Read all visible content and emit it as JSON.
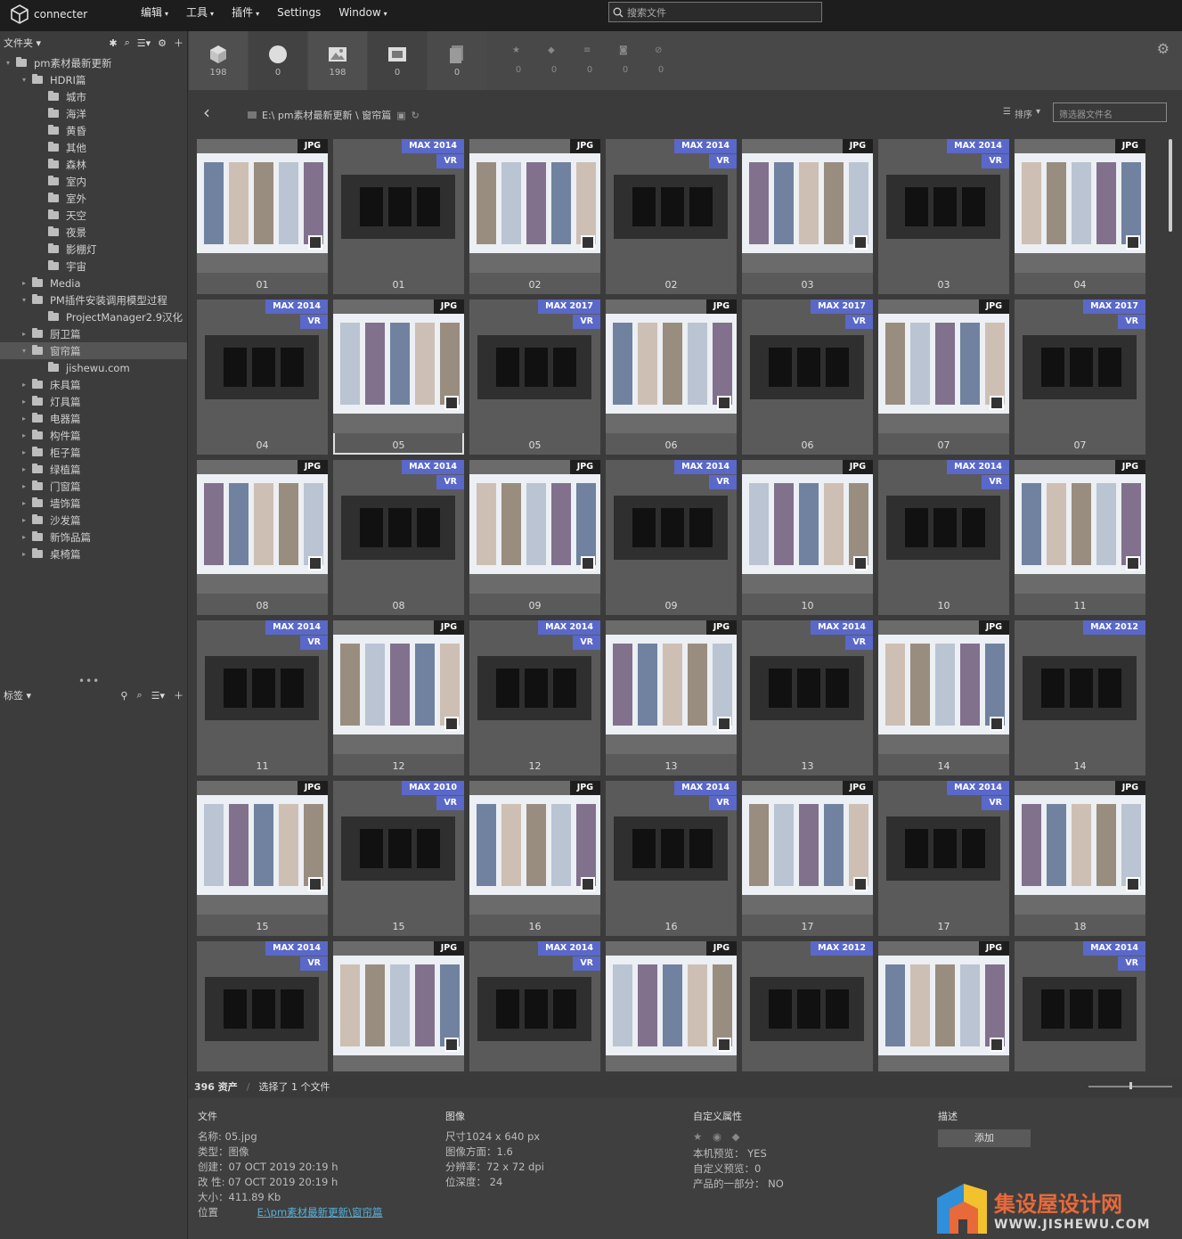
{
  "app": {
    "name": "connecter"
  },
  "menu": [
    {
      "label": "编辑",
      "caret": true
    },
    {
      "label": "工具",
      "caret": true
    },
    {
      "label": "插件",
      "caret": true
    },
    {
      "label": "Settings",
      "caret": false
    },
    {
      "label": "Window",
      "caret": true
    }
  ],
  "search": {
    "placeholder": "搜索文件"
  },
  "sidebar": {
    "header": "文件夹",
    "tree": [
      {
        "label": "pm素材最新更新",
        "depth": 0,
        "arrow": "▾"
      },
      {
        "label": "HDRI篇",
        "depth": 1,
        "arrow": "▾"
      },
      {
        "label": "城市",
        "depth": 2,
        "arrow": ""
      },
      {
        "label": "海洋",
        "depth": 2,
        "arrow": ""
      },
      {
        "label": "黄昏",
        "depth": 2,
        "arrow": ""
      },
      {
        "label": "其他",
        "depth": 2,
        "arrow": ""
      },
      {
        "label": "森林",
        "depth": 2,
        "arrow": ""
      },
      {
        "label": "室内",
        "depth": 2,
        "arrow": ""
      },
      {
        "label": "室外",
        "depth": 2,
        "arrow": ""
      },
      {
        "label": "天空",
        "depth": 2,
        "arrow": ""
      },
      {
        "label": "夜景",
        "depth": 2,
        "arrow": ""
      },
      {
        "label": "影棚灯",
        "depth": 2,
        "arrow": ""
      },
      {
        "label": "宇宙",
        "depth": 2,
        "arrow": ""
      },
      {
        "label": "Media",
        "depth": 1,
        "arrow": "▸"
      },
      {
        "label": "PM插件安装调用模型过程",
        "depth": 1,
        "arrow": "▾"
      },
      {
        "label": "ProjectManager2.9汉化",
        "depth": 2,
        "arrow": ""
      },
      {
        "label": "厨卫篇",
        "depth": 1,
        "arrow": "▸"
      },
      {
        "label": "窗帘篇",
        "depth": 1,
        "arrow": "▾",
        "selected": true
      },
      {
        "label": "jishewu.com",
        "depth": 2,
        "arrow": ""
      },
      {
        "label": "床具篇",
        "depth": 1,
        "arrow": "▸"
      },
      {
        "label": "灯具篇",
        "depth": 1,
        "arrow": "▸"
      },
      {
        "label": "电器篇",
        "depth": 1,
        "arrow": "▸"
      },
      {
        "label": "构件篇",
        "depth": 1,
        "arrow": "▸"
      },
      {
        "label": "柜子篇",
        "depth": 1,
        "arrow": "▸"
      },
      {
        "label": "绿植篇",
        "depth": 1,
        "arrow": "▸"
      },
      {
        "label": "门窗篇",
        "depth": 1,
        "arrow": "▸"
      },
      {
        "label": "墙饰篇",
        "depth": 1,
        "arrow": "▸"
      },
      {
        "label": "沙发篇",
        "depth": 1,
        "arrow": "▸"
      },
      {
        "label": "新饰品篇",
        "depth": 1,
        "arrow": "▸"
      },
      {
        "label": "桌椅篇",
        "depth": 1,
        "arrow": "▸"
      }
    ],
    "tags_header": "标签"
  },
  "toolbar": {
    "types": [
      {
        "icon": "cube-icon",
        "count": "198"
      },
      {
        "icon": "sphere-icon",
        "count": "0"
      },
      {
        "icon": "image-icon",
        "count": "198"
      },
      {
        "icon": "film-icon",
        "count": "0"
      },
      {
        "icon": "document-icon",
        "count": "0"
      }
    ],
    "filters": [
      {
        "icon": "star-icon",
        "count": "0"
      },
      {
        "icon": "tag-icon",
        "count": "0"
      },
      {
        "icon": "lines-icon",
        "count": "0"
      },
      {
        "icon": "camera-icon",
        "count": "0"
      },
      {
        "icon": "ban-icon",
        "count": "0"
      }
    ]
  },
  "path": {
    "text": "E:\\ pm素材最新更新 \\ 窗帘篇"
  },
  "sort": {
    "label": "排序"
  },
  "filter_input": {
    "placeholder": "筛选器文件名"
  },
  "assets": [
    {
      "label": "01",
      "badge": "JPG"
    },
    {
      "label": "01",
      "badge": "MAX 2014",
      "vr": true
    },
    {
      "label": "02",
      "badge": "JPG"
    },
    {
      "label": "02",
      "badge": "MAX 2014",
      "vr": true
    },
    {
      "label": "03",
      "badge": "JPG"
    },
    {
      "label": "03",
      "badge": "MAX 2014",
      "vr": true
    },
    {
      "label": "04",
      "badge": "JPG"
    },
    {
      "label": "04",
      "badge": "MAX 2014",
      "vr": true
    },
    {
      "label": "05",
      "badge": "JPG",
      "selected": true
    },
    {
      "label": "05",
      "badge": "MAX 2017",
      "vr": true
    },
    {
      "label": "06",
      "badge": "JPG"
    },
    {
      "label": "06",
      "badge": "MAX 2017",
      "vr": true
    },
    {
      "label": "07",
      "badge": "JPG"
    },
    {
      "label": "07",
      "badge": "MAX 2017",
      "vr": true
    },
    {
      "label": "08",
      "badge": "JPG"
    },
    {
      "label": "08",
      "badge": "MAX 2014",
      "vr": true
    },
    {
      "label": "09",
      "badge": "JPG"
    },
    {
      "label": "09",
      "badge": "MAX 2014",
      "vr": true
    },
    {
      "label": "10",
      "badge": "JPG"
    },
    {
      "label": "10",
      "badge": "MAX 2014",
      "vr": true
    },
    {
      "label": "11",
      "badge": "JPG"
    },
    {
      "label": "11",
      "badge": "MAX 2014",
      "vr": true
    },
    {
      "label": "12",
      "badge": "JPG"
    },
    {
      "label": "12",
      "badge": "MAX 2014",
      "vr": true
    },
    {
      "label": "13",
      "badge": "JPG"
    },
    {
      "label": "13",
      "badge": "MAX 2014",
      "vr": true
    },
    {
      "label": "14",
      "badge": "JPG"
    },
    {
      "label": "14",
      "badge": "MAX 2012",
      "vr": false
    },
    {
      "label": "15",
      "badge": "JPG"
    },
    {
      "label": "15",
      "badge": "MAX 2010",
      "vr": true
    },
    {
      "label": "16",
      "badge": "JPG"
    },
    {
      "label": "16",
      "badge": "MAX 2014",
      "vr": true
    },
    {
      "label": "17",
      "badge": "JPG"
    },
    {
      "label": "17",
      "badge": "MAX 2014",
      "vr": true
    },
    {
      "label": "18",
      "badge": "JPG"
    },
    {
      "label": "",
      "badge": "MAX 2014",
      "vr": true
    },
    {
      "label": "",
      "badge": "JPG"
    },
    {
      "label": "",
      "badge": "MAX 2014",
      "vr": true
    },
    {
      "label": "",
      "badge": "JPG"
    },
    {
      "label": "",
      "badge": "MAX 2012",
      "vr": false
    },
    {
      "label": "",
      "badge": "JPG"
    },
    {
      "label": "",
      "badge": "MAX 2014",
      "vr": true
    }
  ],
  "status": {
    "count": "396 资产",
    "selected": "选择了 1 个文件"
  },
  "info": {
    "file": {
      "heading": "文件",
      "name": "名称:  05.jpg",
      "type": "类型：图像",
      "created": "创建：07 OCT 2019 20:19 h",
      "modified": "改 性: 07 OCT 2019 20:19 h",
      "size": "大小：411.89 Kb",
      "location_label": "位置",
      "location": "E:\\pm素材最新更新\\窗帘篇"
    },
    "image": {
      "heading": "图像",
      "dimensions": "尺寸1024 x 640 px",
      "aspect": "图像方面：1.6",
      "resolution": "分辨率：72 x 72 dpi",
      "depth": "位深度：  24"
    },
    "custom": {
      "heading": "自定义属性",
      "local_preview": "本机预览：  YES",
      "custom_preview": "自定义预览：0",
      "part_of_product": "产品的一部分：  NO"
    },
    "description": {
      "heading": "描述",
      "add": "添加"
    }
  },
  "watermark": {
    "cn": "集设屋设计网",
    "en": "WWW.JISHEWU.COM"
  },
  "colors": {
    "accent_badge": "#5a68c9",
    "link": "#5ab0d6",
    "wm_orange": "#e8693a"
  }
}
